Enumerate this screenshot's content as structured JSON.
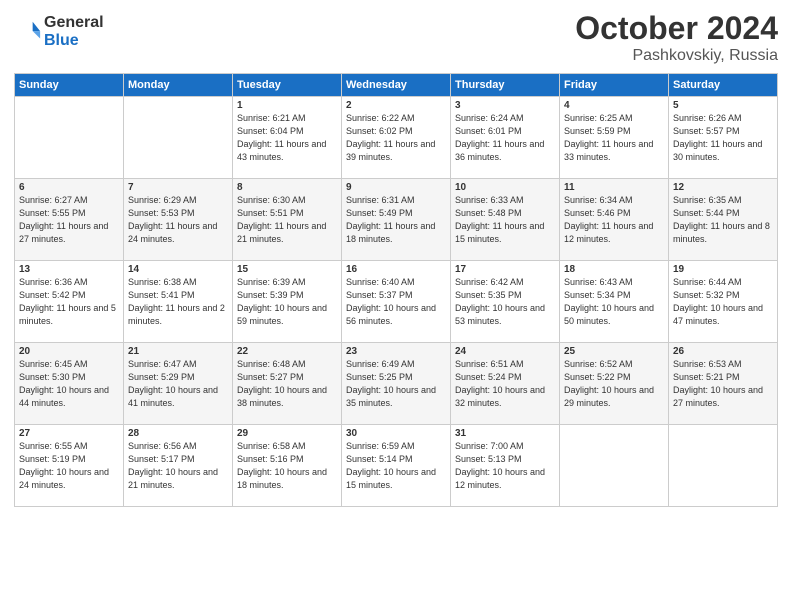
{
  "header": {
    "logo_line1": "General",
    "logo_line2": "Blue",
    "month": "October 2024",
    "location": "Pashkovskiy, Russia"
  },
  "days_of_week": [
    "Sunday",
    "Monday",
    "Tuesday",
    "Wednesday",
    "Thursday",
    "Friday",
    "Saturday"
  ],
  "weeks": [
    [
      {
        "day": "",
        "sunrise": "",
        "sunset": "",
        "daylight": ""
      },
      {
        "day": "",
        "sunrise": "",
        "sunset": "",
        "daylight": ""
      },
      {
        "day": "1",
        "sunrise": "Sunrise: 6:21 AM",
        "sunset": "Sunset: 6:04 PM",
        "daylight": "Daylight: 11 hours and 43 minutes."
      },
      {
        "day": "2",
        "sunrise": "Sunrise: 6:22 AM",
        "sunset": "Sunset: 6:02 PM",
        "daylight": "Daylight: 11 hours and 39 minutes."
      },
      {
        "day": "3",
        "sunrise": "Sunrise: 6:24 AM",
        "sunset": "Sunset: 6:01 PM",
        "daylight": "Daylight: 11 hours and 36 minutes."
      },
      {
        "day": "4",
        "sunrise": "Sunrise: 6:25 AM",
        "sunset": "Sunset: 5:59 PM",
        "daylight": "Daylight: 11 hours and 33 minutes."
      },
      {
        "day": "5",
        "sunrise": "Sunrise: 6:26 AM",
        "sunset": "Sunset: 5:57 PM",
        "daylight": "Daylight: 11 hours and 30 minutes."
      }
    ],
    [
      {
        "day": "6",
        "sunrise": "Sunrise: 6:27 AM",
        "sunset": "Sunset: 5:55 PM",
        "daylight": "Daylight: 11 hours and 27 minutes."
      },
      {
        "day": "7",
        "sunrise": "Sunrise: 6:29 AM",
        "sunset": "Sunset: 5:53 PM",
        "daylight": "Daylight: 11 hours and 24 minutes."
      },
      {
        "day": "8",
        "sunrise": "Sunrise: 6:30 AM",
        "sunset": "Sunset: 5:51 PM",
        "daylight": "Daylight: 11 hours and 21 minutes."
      },
      {
        "day": "9",
        "sunrise": "Sunrise: 6:31 AM",
        "sunset": "Sunset: 5:49 PM",
        "daylight": "Daylight: 11 hours and 18 minutes."
      },
      {
        "day": "10",
        "sunrise": "Sunrise: 6:33 AM",
        "sunset": "Sunset: 5:48 PM",
        "daylight": "Daylight: 11 hours and 15 minutes."
      },
      {
        "day": "11",
        "sunrise": "Sunrise: 6:34 AM",
        "sunset": "Sunset: 5:46 PM",
        "daylight": "Daylight: 11 hours and 12 minutes."
      },
      {
        "day": "12",
        "sunrise": "Sunrise: 6:35 AM",
        "sunset": "Sunset: 5:44 PM",
        "daylight": "Daylight: 11 hours and 8 minutes."
      }
    ],
    [
      {
        "day": "13",
        "sunrise": "Sunrise: 6:36 AM",
        "sunset": "Sunset: 5:42 PM",
        "daylight": "Daylight: 11 hours and 5 minutes."
      },
      {
        "day": "14",
        "sunrise": "Sunrise: 6:38 AM",
        "sunset": "Sunset: 5:41 PM",
        "daylight": "Daylight: 11 hours and 2 minutes."
      },
      {
        "day": "15",
        "sunrise": "Sunrise: 6:39 AM",
        "sunset": "Sunset: 5:39 PM",
        "daylight": "Daylight: 10 hours and 59 minutes."
      },
      {
        "day": "16",
        "sunrise": "Sunrise: 6:40 AM",
        "sunset": "Sunset: 5:37 PM",
        "daylight": "Daylight: 10 hours and 56 minutes."
      },
      {
        "day": "17",
        "sunrise": "Sunrise: 6:42 AM",
        "sunset": "Sunset: 5:35 PM",
        "daylight": "Daylight: 10 hours and 53 minutes."
      },
      {
        "day": "18",
        "sunrise": "Sunrise: 6:43 AM",
        "sunset": "Sunset: 5:34 PM",
        "daylight": "Daylight: 10 hours and 50 minutes."
      },
      {
        "day": "19",
        "sunrise": "Sunrise: 6:44 AM",
        "sunset": "Sunset: 5:32 PM",
        "daylight": "Daylight: 10 hours and 47 minutes."
      }
    ],
    [
      {
        "day": "20",
        "sunrise": "Sunrise: 6:45 AM",
        "sunset": "Sunset: 5:30 PM",
        "daylight": "Daylight: 10 hours and 44 minutes."
      },
      {
        "day": "21",
        "sunrise": "Sunrise: 6:47 AM",
        "sunset": "Sunset: 5:29 PM",
        "daylight": "Daylight: 10 hours and 41 minutes."
      },
      {
        "day": "22",
        "sunrise": "Sunrise: 6:48 AM",
        "sunset": "Sunset: 5:27 PM",
        "daylight": "Daylight: 10 hours and 38 minutes."
      },
      {
        "day": "23",
        "sunrise": "Sunrise: 6:49 AM",
        "sunset": "Sunset: 5:25 PM",
        "daylight": "Daylight: 10 hours and 35 minutes."
      },
      {
        "day": "24",
        "sunrise": "Sunrise: 6:51 AM",
        "sunset": "Sunset: 5:24 PM",
        "daylight": "Daylight: 10 hours and 32 minutes."
      },
      {
        "day": "25",
        "sunrise": "Sunrise: 6:52 AM",
        "sunset": "Sunset: 5:22 PM",
        "daylight": "Daylight: 10 hours and 29 minutes."
      },
      {
        "day": "26",
        "sunrise": "Sunrise: 6:53 AM",
        "sunset": "Sunset: 5:21 PM",
        "daylight": "Daylight: 10 hours and 27 minutes."
      }
    ],
    [
      {
        "day": "27",
        "sunrise": "Sunrise: 6:55 AM",
        "sunset": "Sunset: 5:19 PM",
        "daylight": "Daylight: 10 hours and 24 minutes."
      },
      {
        "day": "28",
        "sunrise": "Sunrise: 6:56 AM",
        "sunset": "Sunset: 5:17 PM",
        "daylight": "Daylight: 10 hours and 21 minutes."
      },
      {
        "day": "29",
        "sunrise": "Sunrise: 6:58 AM",
        "sunset": "Sunset: 5:16 PM",
        "daylight": "Daylight: 10 hours and 18 minutes."
      },
      {
        "day": "30",
        "sunrise": "Sunrise: 6:59 AM",
        "sunset": "Sunset: 5:14 PM",
        "daylight": "Daylight: 10 hours and 15 minutes."
      },
      {
        "day": "31",
        "sunrise": "Sunrise: 7:00 AM",
        "sunset": "Sunset: 5:13 PM",
        "daylight": "Daylight: 10 hours and 12 minutes."
      },
      {
        "day": "",
        "sunrise": "",
        "sunset": "",
        "daylight": ""
      },
      {
        "day": "",
        "sunrise": "",
        "sunset": "",
        "daylight": ""
      }
    ]
  ]
}
